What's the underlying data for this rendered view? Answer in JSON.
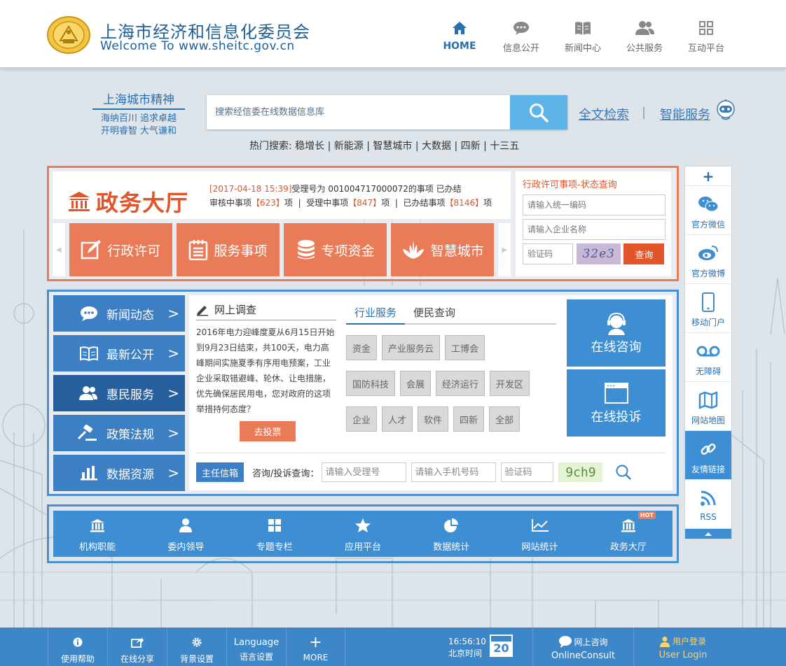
{
  "header": {
    "title": "上海市经济和信息化委员会",
    "subtitle": "Welcome To www.sheitc.gov.cn",
    "nav": [
      {
        "label": "HOME",
        "icon": "home-icon"
      },
      {
        "label": "信息公开",
        "icon": "chat-bubble-icon"
      },
      {
        "label": "新闻中心",
        "icon": "book-icon"
      },
      {
        "label": "公共服务",
        "icon": "people-icon"
      },
      {
        "label": "互动平台",
        "icon": "grid-icon"
      }
    ]
  },
  "spirit": {
    "title": "上海城市精神",
    "line1": "海纳百川 追求卓越",
    "line2": "开明睿智 大气谦和"
  },
  "search": {
    "placeholder": "搜索经信委在线数据信息库",
    "fulltext": "全文检索",
    "separator": "|",
    "smart": "智能服务",
    "hot_label": "热门搜索:",
    "hot_keywords": [
      "稳增长",
      "新能源",
      "智慧城市",
      "大数据",
      "四新",
      "十三五"
    ]
  },
  "zhengwu": {
    "title": "政务大厅",
    "news_time": "[2017-04-18 15:39]",
    "news_text": "受理号为 001004717000072的事项 已办结",
    "stat1_label": "审核中事项",
    "stat1_value": "【623】",
    "stat1_unit": "项",
    "stat2_label": "受理中事项",
    "stat2_value": "【847】",
    "stat2_unit": "项",
    "stat3_label": "已办结事项",
    "stat3_value": "【8146】",
    "stat3_unit": "项",
    "divider": "|",
    "tiles": [
      "行政许可",
      "服务事项",
      "专项资金",
      "智慧城市"
    ],
    "query_title": "行政许可事项-状态查询",
    "code_placeholder": "请输入统一编码",
    "company_placeholder": "请输入企业名称",
    "captcha_placeholder": "验证码",
    "captcha_text": "32e3",
    "query_button": "查询"
  },
  "left_nav": [
    "新闻动态",
    "最新公开",
    "惠民服务",
    "政策法规",
    "数据资源"
  ],
  "survey": {
    "title": "网上调查",
    "text": "2016年电力迎峰度夏从6月15日开始到9月23日结束，共100天，电力高峰期间实施夏季有序用电预案，工业企业采取错避峰、轮休、让电措施，优先确保居民用电，您对政府的这项举措持何态度？",
    "vote_button": "去投票"
  },
  "service_tabs": [
    "行业服务",
    "便民查询"
  ],
  "tags": [
    [
      "资金",
      "产业服务云",
      "工博会"
    ],
    [
      "国防科技",
      "会展",
      "经济运行",
      "开发区"
    ],
    [
      "企业",
      "人才",
      "软件",
      "四新",
      "全部"
    ]
  ],
  "big_buttons": [
    "在线咨询",
    "在线投诉"
  ],
  "mailbox": {
    "button": "主任信箱",
    "label": "咨询/投诉查询：",
    "accept_placeholder": "请输入受理号",
    "phone_placeholder": "请输入手机号码",
    "captcha_placeholder": "验证码",
    "captcha_text": "9ch9"
  },
  "quick_links": [
    {
      "label": "机构职能",
      "icon": "institution-icon"
    },
    {
      "label": "委内领导",
      "icon": "person-icon"
    },
    {
      "label": "专题专栏",
      "icon": "grid-icon"
    },
    {
      "label": "应用平台",
      "icon": "star-icon"
    },
    {
      "label": "数据统计",
      "icon": "pie-chart-icon"
    },
    {
      "label": "网站统计",
      "icon": "line-chart-icon"
    },
    {
      "label": "政务大厅",
      "icon": "institution-icon",
      "badge": "HOT"
    }
  ],
  "float_bar": {
    "plus": "+",
    "items": [
      "官方微信",
      "官方微博",
      "移动门户",
      "无障碍",
      "网站地图",
      "友情链接",
      "RSS"
    ]
  },
  "footer": {
    "help": "使用帮助",
    "share": "在线分享",
    "bg": "背景设置",
    "lang_en": "Language",
    "lang_cn": "语言设置",
    "more": "MORE",
    "more_icon": "+",
    "time": "16:56:10",
    "time_label": "北京时间",
    "date": "20",
    "consult_cn": "网上咨询",
    "consult_en": "OnlineConsult",
    "login_cn": "用户登录",
    "login_en": "User Login"
  },
  "colors": {
    "brand_blue": "#3d86c8",
    "accent_orange": "#ea7b58",
    "dark_blue": "#255f9d",
    "search_blue": "#5eb4e8"
  }
}
